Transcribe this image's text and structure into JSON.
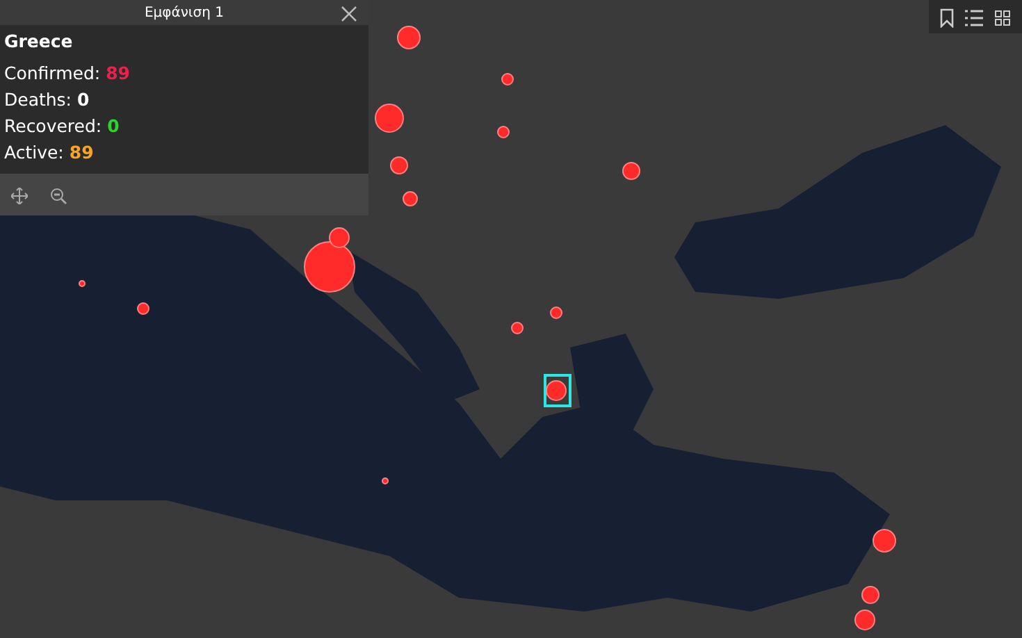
{
  "popup": {
    "title": "Εμφάνιση 1",
    "country": "Greece",
    "stats": [
      {
        "label": "Confirmed:",
        "value": "89",
        "color": "#e8224a"
      },
      {
        "label": "Deaths:",
        "value": "0",
        "color": "#ffffff"
      },
      {
        "label": "Recovered:",
        "value": "0",
        "color": "#2bd42b"
      },
      {
        "label": "Active:",
        "value": "89",
        "color": "#f5a623"
      }
    ]
  }
}
